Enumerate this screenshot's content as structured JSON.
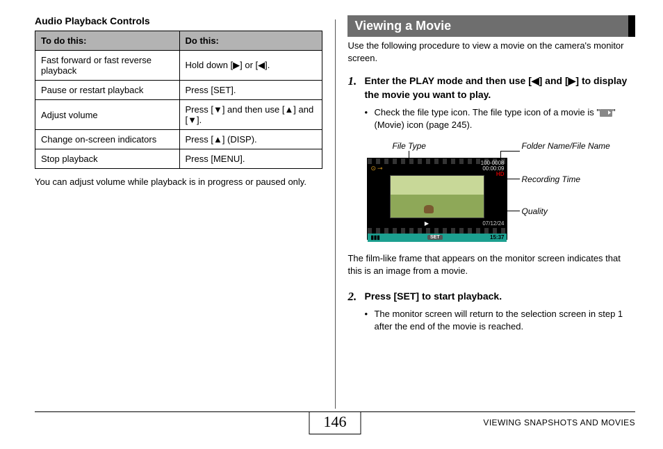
{
  "left": {
    "heading": "Audio Playback Controls",
    "table": {
      "head1": "To do this:",
      "head2": "Do this:",
      "rows": [
        {
          "a": "Fast forward or fast reverse playback",
          "b": "Hold down [▶] or [◀]."
        },
        {
          "a": "Pause or restart playback",
          "b": "Press [SET]."
        },
        {
          "a": "Adjust volume",
          "b": "Press [▼] and then use [▲] and [▼]."
        },
        {
          "a": "Change on-screen indicators",
          "b": "Press [▲] (DISP)."
        },
        {
          "a": "Stop playback",
          "b": "Press [MENU]."
        }
      ]
    },
    "note": "You can adjust volume while playback is in progress or paused only."
  },
  "right": {
    "banner": "Viewing a Movie",
    "intro": "Use the following procedure to view a movie on the camera's monitor screen.",
    "step1_num": "1.",
    "step1_title": "Enter the PLAY mode and then use [◀] and [▶] to display the movie you want to play.",
    "step1_bullet_a": "Check the file type icon. The file type icon of a movie is \"",
    "step1_bullet_b": "\" (Movie) icon (page 245).",
    "fig": {
      "file_type": "File Type",
      "folder": "Folder Name/File Name",
      "recording": "Recording Time",
      "quality": "Quality",
      "folder_val": "100-0008",
      "time_val": "00:00:09",
      "hd": "HD",
      "date": "07/12/24",
      "clock": "15:37",
      "batt": "▮▮▮",
      "set": "SET"
    },
    "followup": "The film-like frame that appears on the monitor screen indicates that this is an image from a movie.",
    "step2_num": "2.",
    "step2_title": "Press [SET] to start playback.",
    "step2_bullet": "The monitor screen will return to the selection screen in step 1 after the end of the movie is reached."
  },
  "footer": {
    "page": "146",
    "section": "VIEWING SNAPSHOTS AND MOVIES"
  }
}
